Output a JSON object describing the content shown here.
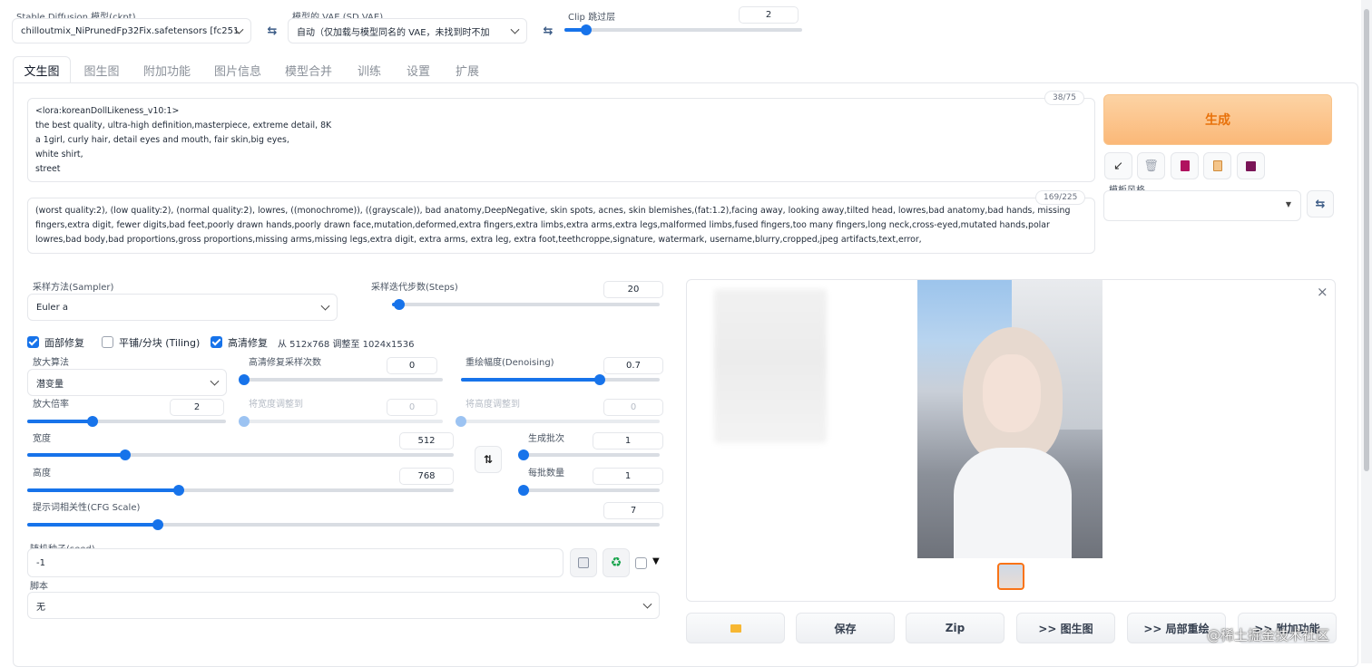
{
  "top": {
    "ckpt_label": "Stable Diffusion 模型(ckpt)",
    "ckpt_value": "chilloutmix_NiPrunedFp32Fix.safetensors [fc251",
    "vae_label": "模型的 VAE (SD VAE)",
    "vae_value": "自动（仅加载与模型同名的 VAE，未找到时不加",
    "clip_label": "Clip 跳过层",
    "clip_value": "2",
    "clip_level": 0.09
  },
  "tabs": [
    "文生图",
    "图生图",
    "附加功能",
    "图片信息",
    "模型合并",
    "训练",
    "设置",
    "扩展"
  ],
  "prompt": {
    "positive": "<lora:koreanDollLikeness_v10:1>\nthe best quality, ultra-high definition,masterpiece, extreme detail, 8K\na 1girl, curly hair, detail eyes and mouth, fair skin,big eyes,\nwhite shirt,\nstreet",
    "positive_count": "38/75",
    "negative": "(worst quality:2), (low quality:2), (normal quality:2), lowres, ((monochrome)), ((grayscale)), bad anatomy,DeepNegative, skin spots, acnes, skin blemishes,(fat:1.2),facing away, looking away,tilted head, lowres,bad anatomy,bad hands, missing fingers,extra digit, fewer digits,bad feet,poorly drawn hands,poorly drawn face,mutation,deformed,extra fingers,extra limbs,extra arms,extra legs,malformed limbs,fused fingers,too many fingers,long neck,cross-eyed,mutated hands,polar lowres,bad body,bad proportions,gross proportions,missing arms,missing legs,extra digit, extra arms, extra leg, extra foot,teethcroppe,signature, watermark, username,blurry,cropped,jpeg artifacts,text,error,",
    "negative_count": "169/225"
  },
  "side": {
    "generate_label": "生成",
    "style_label": "模板风格",
    "style_value": "",
    "tool_icons": [
      "arrow-icon",
      "trash-icon",
      "book-icon",
      "clipboard-icon",
      "save-icon"
    ]
  },
  "params": {
    "sampler_label": "采样方法(Sampler)",
    "sampler_value": "Euler a",
    "steps_label": "采样迭代步数(Steps)",
    "steps_value": "20",
    "steps_level": 0.027,
    "face_restore_label": "面部修复",
    "tiling_label": "平铺/分块 (Tiling)",
    "hires_label": "高清修复",
    "hires_info": "从 512x768 调整至 1024x1536",
    "upscaler_label": "放大算法",
    "upscaler_value": "潜变量",
    "hires_steps_label": "高清修复采样次数",
    "hires_steps_value": "0",
    "hires_steps_level": 0,
    "denoise_label": "重绘幅度(Denoising)",
    "denoise_value": "0.7",
    "denoise_level": 0.7,
    "upscale_by_label": "放大倍率",
    "upscale_by_value": "2",
    "upscale_by_level": 0.33,
    "resize_w_label": "将宽度调整到",
    "resize_w_value": "0",
    "resize_w_level": 0,
    "resize_h_label": "将高度调整到",
    "resize_h_value": "0",
    "resize_h_level": 0,
    "width_label": "宽度",
    "width_value": "512",
    "width_level": 0.229,
    "height_label": "高度",
    "height_value": "768",
    "height_level": 0.355,
    "batch_count_label": "生成批次",
    "batch_count_value": "1",
    "batch_count_level": 0,
    "batch_size_label": "每批数量",
    "batch_size_value": "1",
    "batch_size_level": 0,
    "cfg_label": "提示词相关性(CFG Scale)",
    "cfg_value": "7",
    "cfg_level": 0.207,
    "seed_label": "随机种子(seed)",
    "seed_value": "-1",
    "script_label": "脚本",
    "script_value": "无"
  },
  "output": {
    "buttons": [
      "",
      "保存",
      "Zip",
      ">> 图生图",
      ">> 局部重绘",
      ">> 附加功能"
    ],
    "close_glyph": "×"
  },
  "watermark": "@稀土掘金技术社区",
  "colors": {
    "accent": "#1773ea",
    "generate_text": "#e8710a",
    "generate_bg": "#fbc58a"
  }
}
